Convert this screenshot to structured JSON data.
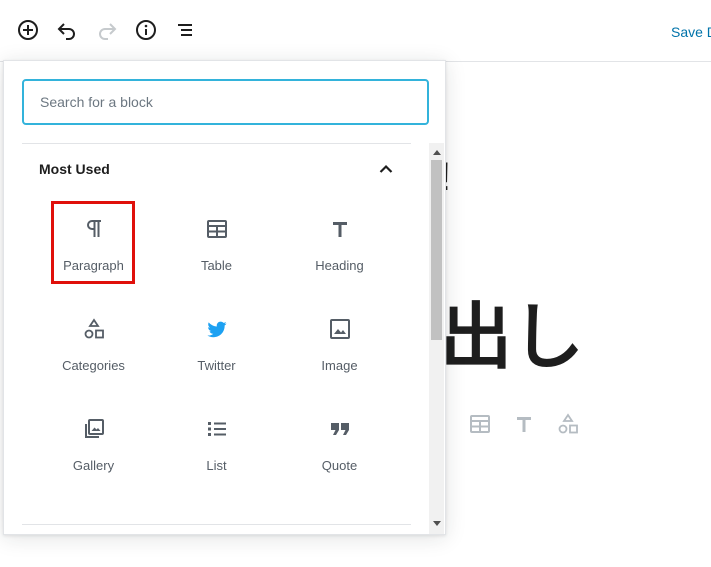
{
  "toolbar": {
    "save_label": "Save D",
    "icons": [
      "add-block-icon",
      "undo-icon",
      "redo-icon",
      "info-icon",
      "block-navigation-icon"
    ]
  },
  "background": {
    "exclaim": "!",
    "heading_fragment": "出し"
  },
  "inserter": {
    "search_placeholder": "Search for a block",
    "panel_title": "Most Used",
    "blocks": [
      {
        "label": "Paragraph",
        "icon": "paragraph-icon"
      },
      {
        "label": "Table",
        "icon": "table-icon"
      },
      {
        "label": "Heading",
        "icon": "heading-icon"
      },
      {
        "label": "Categories",
        "icon": "categories-icon"
      },
      {
        "label": "Twitter",
        "icon": "twitter-icon"
      },
      {
        "label": "Image",
        "icon": "image-icon"
      },
      {
        "label": "Gallery",
        "icon": "gallery-icon"
      },
      {
        "label": "List",
        "icon": "list-icon"
      },
      {
        "label": "Quote",
        "icon": "quote-icon"
      }
    ]
  },
  "colors": {
    "accent": "#0073aa",
    "focus_border": "#33b3db",
    "twitter": "#1da1f2",
    "highlight": "#e0100b",
    "icon": "#555d66"
  }
}
